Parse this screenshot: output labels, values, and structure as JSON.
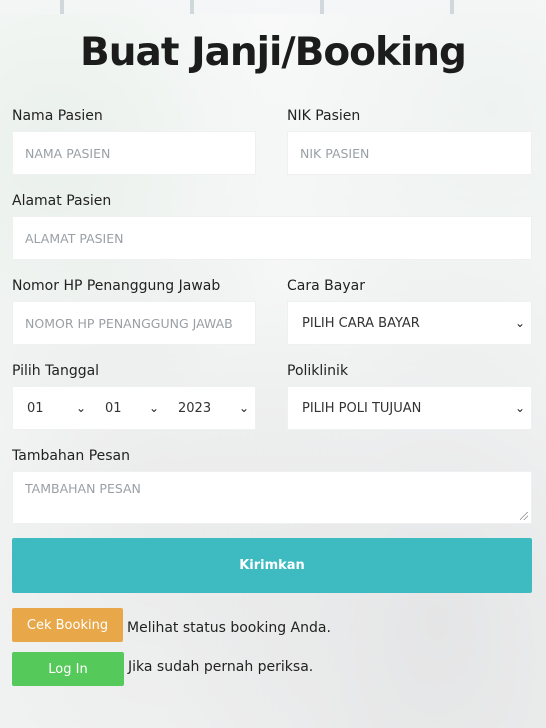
{
  "title": "Buat Janji/Booking",
  "form": {
    "nama": {
      "label": "Nama Pasien",
      "placeholder": "NAMA PASIEN"
    },
    "nik": {
      "label": "NIK Pasien",
      "placeholder": "NIK PASIEN"
    },
    "alamat": {
      "label": "Alamat Pasien",
      "placeholder": "ALAMAT PASIEN"
    },
    "nomor_hp": {
      "label": "Nomor HP Penanggung Jawab",
      "placeholder": "NOMOR HP PENANGGUNG JAWAB"
    },
    "cara_bayar": {
      "label": "Cara Bayar",
      "selected": "PILIH CARA BAYAR"
    },
    "tanggal": {
      "label": "Pilih Tanggal",
      "day": "01",
      "month": "01",
      "year": "2023"
    },
    "poliklinik": {
      "label": "Poliklinik",
      "selected": "PILIH POLI TUJUAN"
    },
    "pesan": {
      "label": "Tambahan Pesan",
      "placeholder": "TAMBAHAN PESAN"
    }
  },
  "submit_label": "Kirimkan",
  "cek_booking": {
    "label": "Cek Booking",
    "hint": "Melihat status booking Anda.",
    "color": "#e8a84a"
  },
  "login": {
    "label": "Log In",
    "hint": "Jika sudah pernah periksa.",
    "color": "#55c95a"
  },
  "submit_color": "#3dbbc0",
  "icons": {
    "select_arrow": "chevron-down-icon",
    "resize": "resize-handle-icon"
  }
}
